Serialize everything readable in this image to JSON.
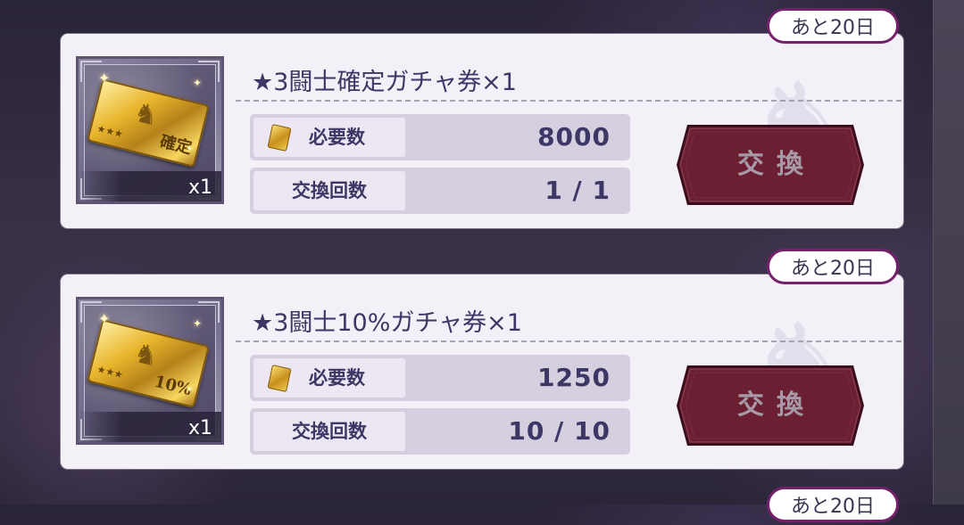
{
  "items": [
    {
      "remaining": "あと20日",
      "title": "★3闘士確定ガチャ券×1",
      "ticket_mark": "確定",
      "ticket_stars": "★★★",
      "quantity": "x1",
      "cost_label": "必要数",
      "cost_value": "8000",
      "count_label": "交換回数",
      "count_value": "1 / 1",
      "button_label": "交換"
    },
    {
      "remaining": "あと20日",
      "title": "★3闘士10%ガチャ券×1",
      "ticket_mark": "10%",
      "ticket_stars": "★★★",
      "quantity": "x1",
      "cost_label": "必要数",
      "cost_value": "1250",
      "count_label": "交換回数",
      "count_value": "10 / 10",
      "button_label": "交換"
    }
  ],
  "partial_badge": "あと20日",
  "colors": {
    "button_fill": "#6b1f33",
    "button_border": "#3a0e1c",
    "badge_border": "#74206b",
    "title_text": "#3d3766"
  },
  "icons": {
    "item": "gold-ticket-icon",
    "cost": "ticket-currency-icon",
    "background": "pegasus-emblem-icon"
  }
}
